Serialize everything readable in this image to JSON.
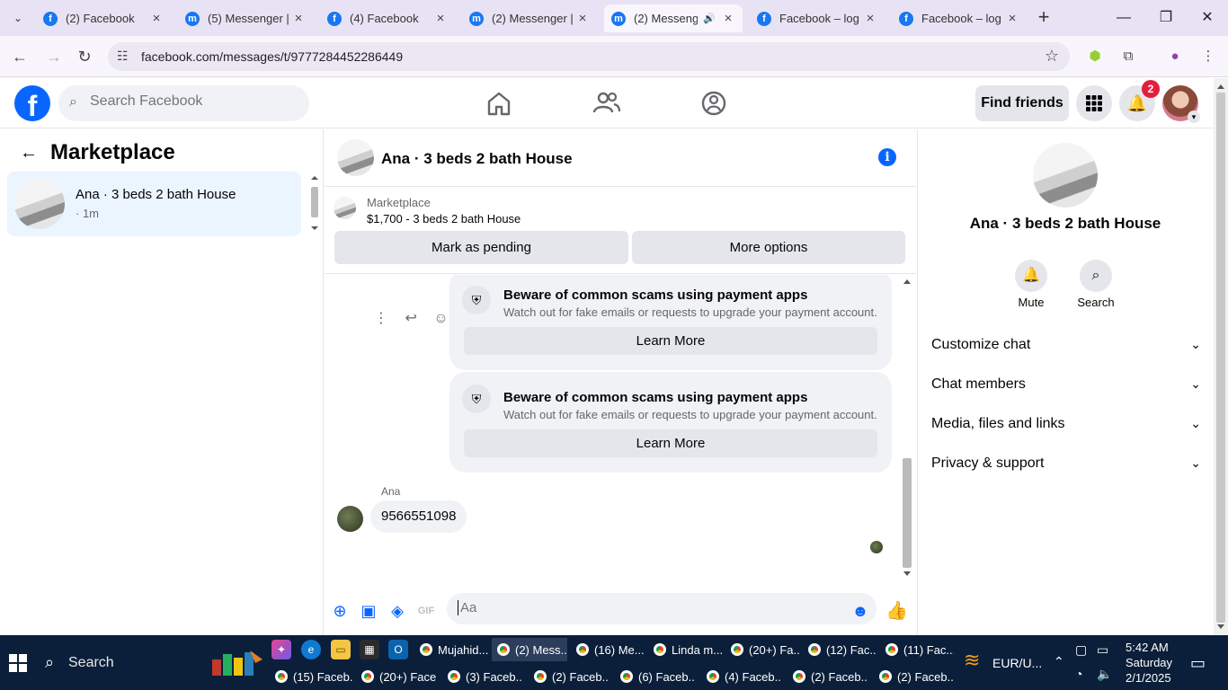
{
  "browser": {
    "tabs": [
      {
        "title": "(2) Facebook"
      },
      {
        "title": "(5) Messenger | Fa"
      },
      {
        "title": "(4) Facebook"
      },
      {
        "title": "(2) Messenger | Fa"
      },
      {
        "title": "(2) Messenger"
      },
      {
        "title": "Facebook – log in"
      },
      {
        "title": "Facebook – log in"
      }
    ],
    "url": "facebook.com/messages/t/9777284452286449"
  },
  "fb": {
    "search_placeholder": "Search Facebook",
    "find_friends": "Find friends",
    "notification_count": "2"
  },
  "left": {
    "title": "Marketplace",
    "conversation": {
      "name": "Ana · 3 beds 2 bath House",
      "time": "· 1m"
    }
  },
  "chat": {
    "header_name": "Ana · 3 beds 2 bath House",
    "listing_source": "Marketplace",
    "listing_price": "$1,700 - 3 beds 2 bath House",
    "mark_pending": "Mark as pending",
    "more_options": "More options",
    "scam_cards": [
      {
        "title": "Beware of common scams using payment apps",
        "body": "Watch out for fake emails or requests to upgrade your payment account.",
        "button": "Learn More"
      },
      {
        "title": "Beware of common scams using payment apps",
        "body": "Watch out for fake emails or requests to upgrade your payment account.",
        "button": "Learn More"
      }
    ],
    "sender": "Ana",
    "message": "9566551098",
    "composer_placeholder": "Aa"
  },
  "right": {
    "name": "Ana · 3 beds 2 bath House",
    "mute": "Mute",
    "search": "Search",
    "sections": [
      "Customize chat",
      "Chat members",
      "Media, files and links",
      "Privacy & support"
    ]
  },
  "taskbar": {
    "search": "Search",
    "row1": [
      "Mujahid...",
      "(2) Mess...",
      "(16) Me...",
      "Linda m...",
      "(20+) Fa...",
      "(12) Fac...",
      "(11) Fac..."
    ],
    "row2": [
      "(15) Faceb...",
      "(20+) Face...",
      "(3) Faceb...",
      "(2) Faceb...",
      "(6) Faceb...",
      "(4) Faceb...",
      "(2) Faceb...",
      "(2) Faceb..."
    ],
    "currency": "EUR/U...",
    "time": "5:42 AM",
    "day": "Saturday",
    "date": "2/1/2025"
  }
}
